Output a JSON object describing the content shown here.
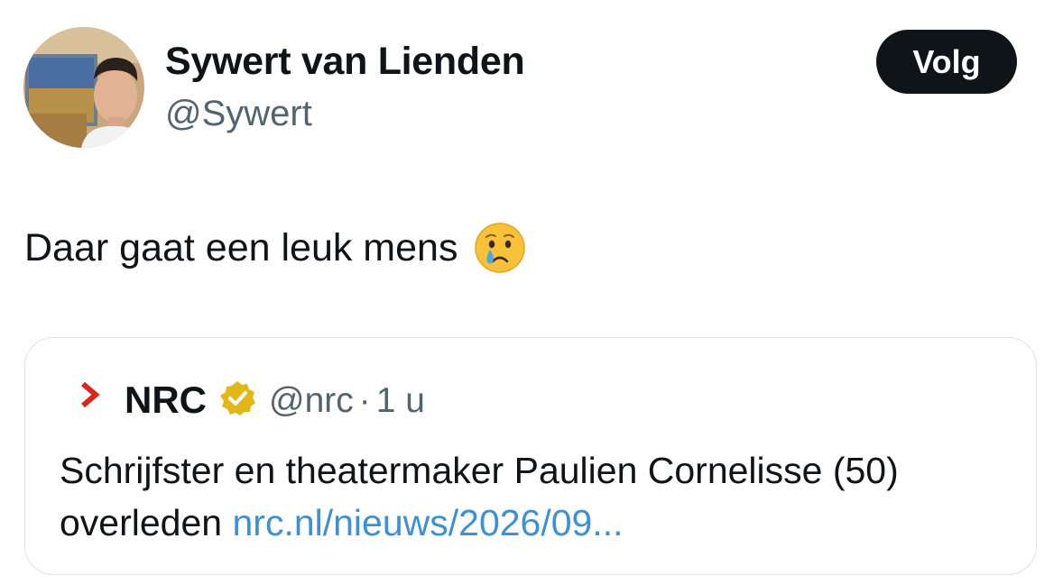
{
  "author": {
    "name": "Sywert van Lienden",
    "handle": "@Sywert"
  },
  "follow_button": {
    "label": "Volg"
  },
  "tweet": {
    "text": "Daar gaat een leuk mens",
    "emoji": "crying-face-emoji"
  },
  "quoted_tweet": {
    "logo": "nrc-chevron-logo",
    "name": "NRC",
    "verified": true,
    "verified_badge_icon": "gold-verified-badge-icon",
    "handle": "@nrc",
    "separator": "·",
    "time": "1 u",
    "text_line_1": "Schrijfster en theatermaker Paulien Cornelisse (50)",
    "text_line_2_prefix": "overleden",
    "link": "nrc.nl/nieuws/2026/09..."
  },
  "colors": {
    "text": "#0f1419",
    "secondary": "#536471",
    "link": "#3d8fd6",
    "button_bg": "#0f1419",
    "nrc_red": "#d6281e",
    "badge_gold": "#e2b719"
  }
}
